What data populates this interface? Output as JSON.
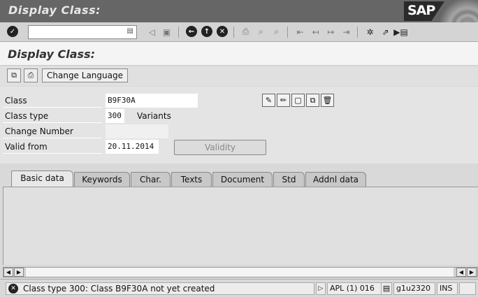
{
  "window": {
    "title": "Display Class:",
    "logo": "SAP"
  },
  "system_toolbar": {
    "command_field": {
      "value": "",
      "placeholder": ""
    },
    "icons": [
      "enter-icon",
      "back-icon",
      "save-icon",
      "back-nav-icon",
      "exit-icon",
      "cancel-icon",
      "print-icon",
      "find-icon",
      "find-next-icon",
      "first-page-icon",
      "prev-page-icon",
      "next-page-icon",
      "last-page-icon",
      "new-session-icon",
      "shortcut-icon",
      "help-icon"
    ]
  },
  "page_title": "Display Class:",
  "app_toolbar": {
    "change_language_label": "Change Language"
  },
  "form": {
    "class_label": "Class",
    "class_value": "B9F30A",
    "class_type_label": "Class type",
    "class_type_value": "300",
    "class_type_desc": "Variants",
    "change_number_label": "Change Number",
    "change_number_value": "",
    "valid_from_label": "Valid from",
    "valid_from_value": "20.11.2014",
    "validity_label": "Validity"
  },
  "tabs": [
    {
      "label": "Basic data",
      "active": true
    },
    {
      "label": "Keywords",
      "active": false
    },
    {
      "label": "Char.",
      "active": false
    },
    {
      "label": "Texts",
      "active": false
    },
    {
      "label": "Document",
      "active": false
    },
    {
      "label": "Std",
      "active": false
    },
    {
      "label": "Addnl data",
      "active": false
    }
  ],
  "status_bar": {
    "message": "Class type 300: Class B9F30A not yet created",
    "system": "APL (1) 016",
    "server": "g1u2320",
    "mode": "INS"
  }
}
